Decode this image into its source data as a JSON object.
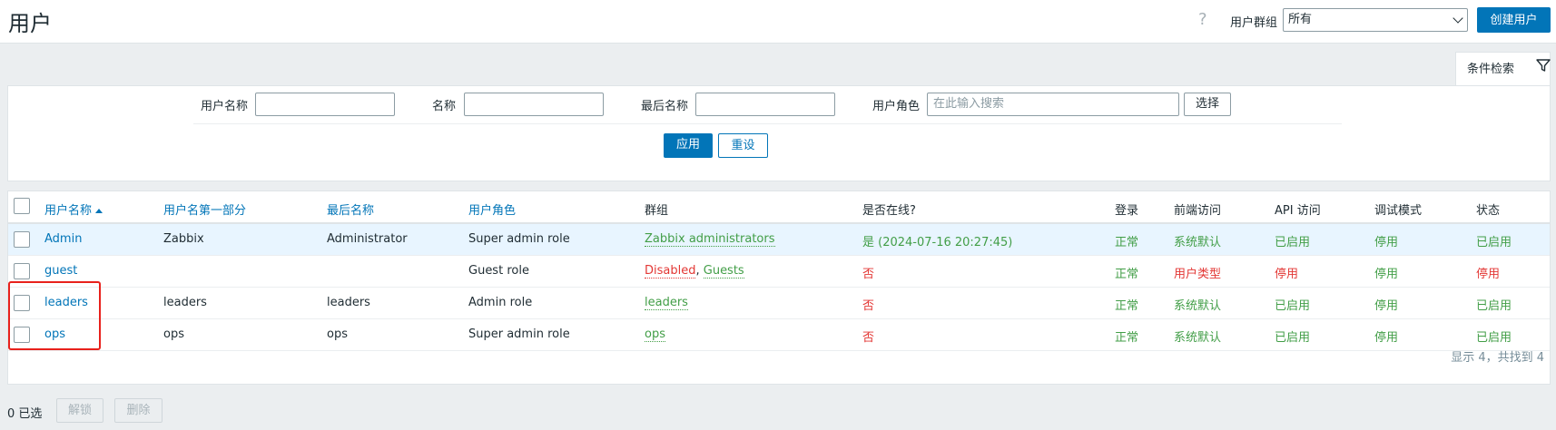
{
  "header": {
    "title": "用户",
    "help_icon": "?",
    "group_label": "用户群组",
    "group_value": "所有",
    "create_label": "创建用户"
  },
  "filter": {
    "tab_label": "条件检索",
    "username_label": "用户名称",
    "name_label": "名称",
    "surname_label": "最后名称",
    "role_label": "用户角色",
    "role_placeholder": "在此输入搜索",
    "select_label": "选择",
    "apply_label": "应用",
    "reset_label": "重设"
  },
  "table": {
    "columns": [
      "用户名称",
      "用户名第一部分",
      "最后名称",
      "用户角色",
      "群组",
      "是否在线?",
      "登录",
      "前端访问",
      "API 访问",
      "调试模式",
      "状态"
    ],
    "rows": [
      {
        "username": "Admin",
        "name": "Zabbix",
        "surname": "Administrator",
        "role": "Super admin role",
        "groups": [
          {
            "text": "Zabbix administrators",
            "status": "enabled"
          }
        ],
        "online": "是 (2024-07-16 20:27:45)",
        "online_status": "yes",
        "login": "正常",
        "frontend": "系统默认",
        "frontend_status": "default",
        "api": "已启用",
        "api_status": "enabled",
        "debug": "停用",
        "status": "已启用",
        "status_state": "enabled"
      },
      {
        "username": "guest",
        "name": "",
        "surname": "",
        "role": "Guest role",
        "groups": [
          {
            "text": "Disabled",
            "status": "disabled"
          },
          {
            "text": "Guests",
            "status": "enabled"
          }
        ],
        "online": "否",
        "online_status": "no",
        "login": "正常",
        "frontend": "用户类型",
        "frontend_status": "custom",
        "api": "停用",
        "api_status": "disabled",
        "debug": "停用",
        "status": "停用",
        "status_state": "disabled"
      },
      {
        "username": "leaders",
        "name": "leaders",
        "surname": "leaders",
        "role": "Admin role",
        "groups": [
          {
            "text": "leaders",
            "status": "enabled"
          }
        ],
        "online": "否",
        "online_status": "no",
        "login": "正常",
        "frontend": "系统默认",
        "frontend_status": "default",
        "api": "已启用",
        "api_status": "enabled",
        "debug": "停用",
        "status": "已启用",
        "status_state": "enabled"
      },
      {
        "username": "ops",
        "name": "ops",
        "surname": "ops",
        "role": "Super admin role",
        "groups": [
          {
            "text": "ops",
            "status": "enabled"
          }
        ],
        "online": "否",
        "online_status": "no",
        "login": "正常",
        "frontend": "系统默认",
        "frontend_status": "default",
        "api": "已启用",
        "api_status": "enabled",
        "debug": "停用",
        "status": "已启用",
        "status_state": "enabled"
      }
    ],
    "summary": "显示 4，共找到 4"
  },
  "footer": {
    "selected": "0 已选",
    "unblock_label": "解锁",
    "delete_label": "删除"
  },
  "colors": {
    "accent": "#0275b8",
    "green": "#429e47",
    "red": "#e33734",
    "highlight": "#e8211c"
  }
}
